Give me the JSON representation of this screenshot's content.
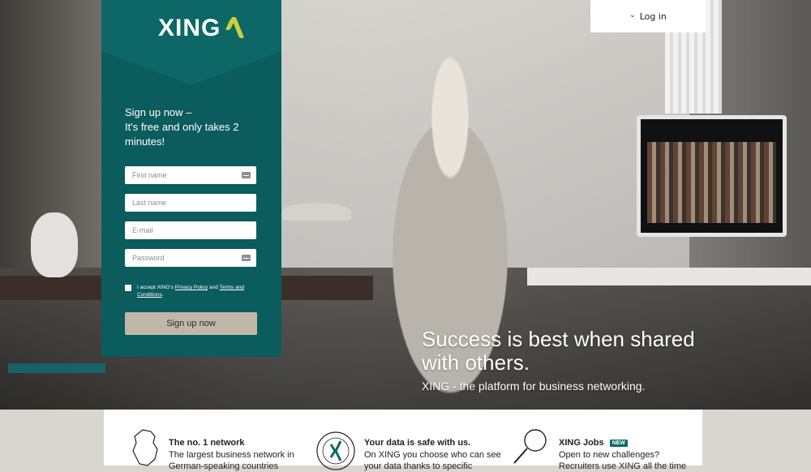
{
  "header": {
    "login_label": "Log in"
  },
  "brand": {
    "logo_text": "XING"
  },
  "signup": {
    "heading_line1": "Sign up now –",
    "heading_line2": "It's free and only takes 2",
    "heading_line3": "minutes!",
    "first_name_placeholder": "First name",
    "last_name_placeholder": "Last name",
    "email_placeholder": "E-mail",
    "password_placeholder": "Password",
    "consent_prefix": "I accept XING's",
    "privacy_link": "Privacy Policy",
    "consent_and": "and",
    "terms_link": "Terms and Conditions",
    "submit_label": "Sign up now"
  },
  "hero": {
    "title_line1": "Success is best when shared",
    "title_line2": "with others.",
    "subtitle": "XING - the platform for business networking."
  },
  "features": [
    {
      "icon": "germany-map-icon",
      "title": "The no. 1 network",
      "line1": "The largest business network in",
      "line2": "German-speaking countries"
    },
    {
      "icon": "data-protection-seal-icon",
      "title": "Your data is safe with us.",
      "line1": "On XING you choose who can see",
      "line2": "your data thanks to specific"
    },
    {
      "icon": "magnifier-icon",
      "title": "XING Jobs",
      "badge": "NEW",
      "line1": "Open to new challenges?",
      "line2": "Recruiters use XING all the time"
    }
  ],
  "colors": {
    "panel": "#0b5c5c",
    "accent": "#c9d13b",
    "button": "#c1b7a8"
  }
}
